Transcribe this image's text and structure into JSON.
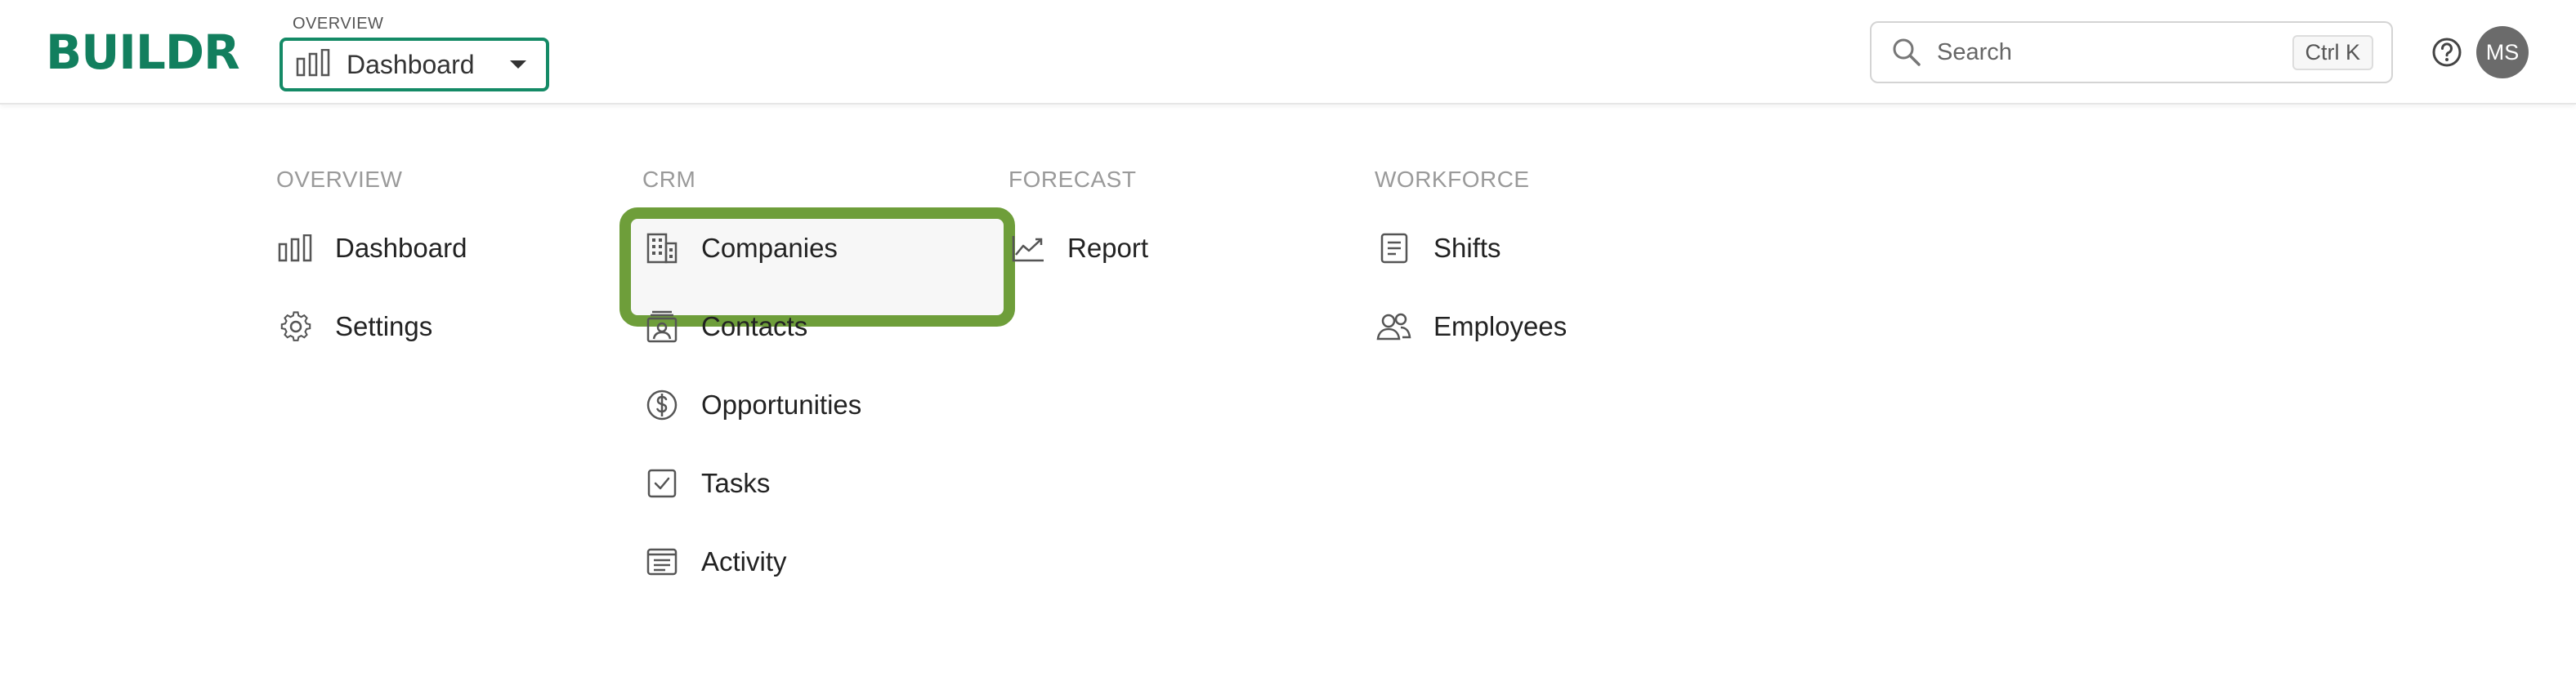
{
  "brand": {
    "logo": "BUILDR",
    "accent": "#127f5e"
  },
  "switcher": {
    "caption": "OVERVIEW",
    "value": "Dashboard"
  },
  "search": {
    "placeholder": "Search",
    "shortcut": "Ctrl K"
  },
  "user": {
    "initials": "MS"
  },
  "menu": {
    "overview": {
      "title": "OVERVIEW",
      "items": [
        {
          "label": "Dashboard",
          "icon": "bar-chart-icon"
        },
        {
          "label": "Settings",
          "icon": "gear-icon"
        }
      ]
    },
    "crm": {
      "title": "CRM",
      "items": [
        {
          "label": "Companies",
          "icon": "building-icon",
          "highlighted": true
        },
        {
          "label": "Contacts",
          "icon": "contact-card-icon"
        },
        {
          "label": "Opportunities",
          "icon": "dollar-circle-icon"
        },
        {
          "label": "Tasks",
          "icon": "checkbox-icon"
        },
        {
          "label": "Activity",
          "icon": "list-document-icon"
        }
      ]
    },
    "forecast": {
      "title": "FORECAST",
      "items": [
        {
          "label": "Report",
          "icon": "trend-chart-icon"
        }
      ]
    },
    "workforce": {
      "title": "WORKFORCE",
      "items": [
        {
          "label": "Shifts",
          "icon": "document-icon"
        },
        {
          "label": "Employees",
          "icon": "people-icon"
        }
      ]
    }
  }
}
